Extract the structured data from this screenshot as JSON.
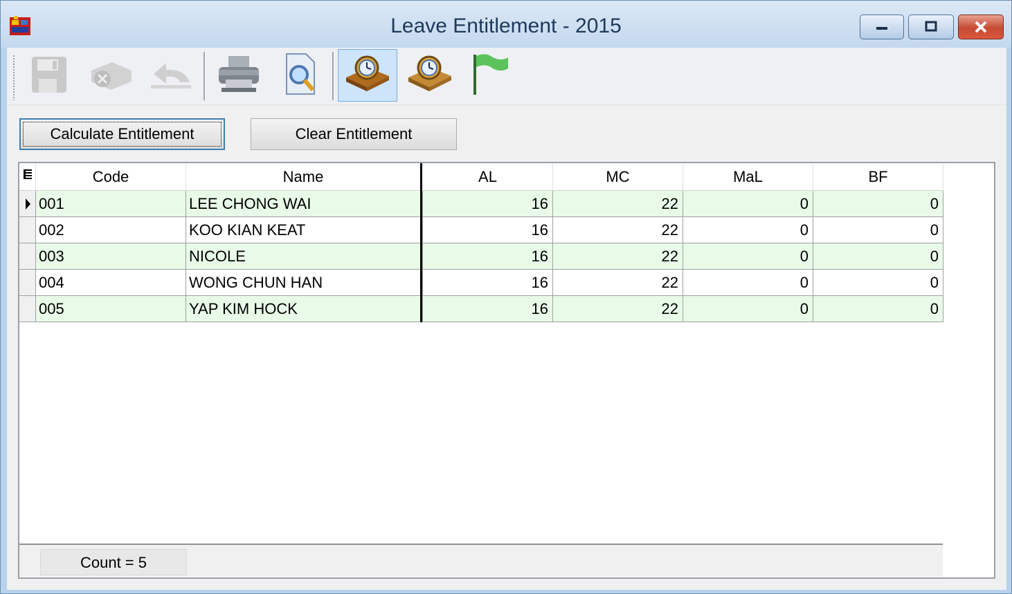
{
  "window": {
    "title": "Leave Entitlement - 2015"
  },
  "toolbar": {
    "items": [
      {
        "icon": "save-icon",
        "enabled": false
      },
      {
        "icon": "cancel-icon",
        "enabled": false
      },
      {
        "icon": "undo-icon",
        "enabled": false
      },
      {
        "icon": "print-icon",
        "enabled": true
      },
      {
        "icon": "print-preview-icon",
        "enabled": true
      },
      {
        "icon": "clock-book-icon",
        "enabled": true,
        "active": true
      },
      {
        "icon": "clock-book-icon",
        "enabled": true
      },
      {
        "icon": "flag-icon",
        "enabled": true
      }
    ]
  },
  "actions": {
    "calculate_label": "Calculate Entitlement",
    "clear_label": "Clear Entitlement"
  },
  "grid": {
    "columns": [
      "Code",
      "Name",
      "AL",
      "MC",
      "MaL",
      "BF"
    ],
    "rows": [
      {
        "code": "001",
        "name": "LEE CHONG WAI",
        "al": "16",
        "mc": "22",
        "mal": "0",
        "bf": "0"
      },
      {
        "code": "002",
        "name": "KOO KIAN KEAT",
        "al": "16",
        "mc": "22",
        "mal": "0",
        "bf": "0"
      },
      {
        "code": "003",
        "name": "NICOLE",
        "al": "16",
        "mc": "22",
        "mal": "0",
        "bf": "0"
      },
      {
        "code": "004",
        "name": "WONG CHUN HAN",
        "al": "16",
        "mc": "22",
        "mal": "0",
        "bf": "0"
      },
      {
        "code": "005",
        "name": "YAP KIM HOCK",
        "al": "16",
        "mc": "22",
        "mal": "0",
        "bf": "0"
      }
    ],
    "footer": {
      "count_text": "Count = 5"
    }
  },
  "colors": {
    "row_alt": "#e8fbe8",
    "title_text": "#1e395b",
    "active_toolbar": "#cde4fb"
  }
}
